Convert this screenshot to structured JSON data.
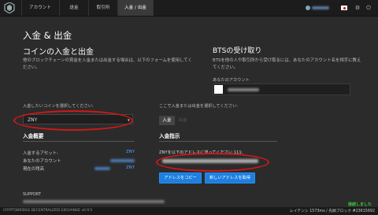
{
  "nav": {
    "tabs": [
      {
        "label": "アカウント",
        "active": false
      },
      {
        "label": "送金",
        "active": false
      },
      {
        "label": "取引所",
        "active": false
      },
      {
        "label": "入金 / 出金",
        "active": true
      }
    ],
    "icons": [
      "logo-icon",
      "account-icon",
      "flag-jp-icon",
      "gear-icon",
      "power-icon"
    ]
  },
  "page": {
    "title": "入金 & 出金",
    "left_heading": "コインの入金と出金",
    "left_intro": "他のブロックチェーンの資金を入金または出金する場合は、以下のフォームを使用してください。",
    "right_heading": "BTSの受け取り",
    "right_intro": "BTSを他の人や取引所から受け取るには、あなたのアカウント名を相手に教えてください。",
    "your_account_label": "あなたのアカウント",
    "select_coin_label": "入金したいコインを選択してください:",
    "select_value": "ZNY",
    "action_label": "ここで入金または出金を選択してください:",
    "deposit_tab": "入金",
    "withdraw_tab": "出金",
    "summary_heading": "入金概要",
    "summary_rows": [
      {
        "label": "入金するアセット:",
        "value": "ZNY"
      },
      {
        "label": "あなたのアカウント",
        "value": ""
      },
      {
        "label": "現在の残高",
        "value": "ZNY"
      }
    ],
    "instructions_heading": "入金指示",
    "instructions_text": "ZNYを以下のアドレスに送ってください 111:",
    "copy_button": "アドレスをコピー",
    "new_address_button": "新しいアドレスを取得",
    "support_heading": "SUPPORT"
  },
  "footer": {
    "left": "CRYPTOBRIDGE DECENTRALIZED EXCHANGE v0.9.5",
    "status": "接続しました",
    "latency": "レイテンシ 1573ms / 先頭ブロック #23615692"
  },
  "colors": {
    "accent": "#1d7fe0",
    "link": "#4fa3ff",
    "highlight_ring": "#d01818",
    "status_green": "#3cc83c"
  }
}
